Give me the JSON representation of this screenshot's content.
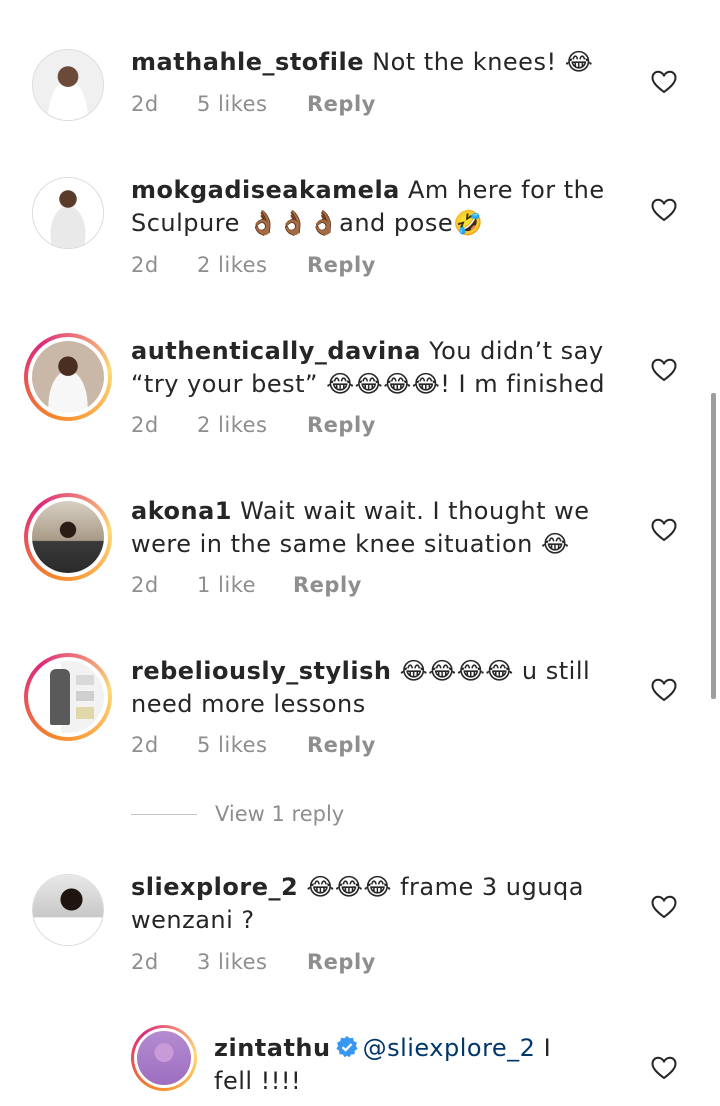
{
  "comments": [
    {
      "username": "mathahle_stofile",
      "text": "Not the knees! 😂",
      "time": "2d",
      "likes": "5 likes",
      "reply": "Reply"
    },
    {
      "username": "mokgadiseakamela",
      "text": "Am here for the Sculpure 👌🏾👌🏾👌🏾and pose🤣",
      "time": "2d",
      "likes": "2 likes",
      "reply": "Reply"
    },
    {
      "username": "authentically_davina",
      "text": "You didn’t say “try your best” 😂😂😂😂! I m finished",
      "time": "2d",
      "likes": "2 likes",
      "reply": "Reply"
    },
    {
      "username": "akona1",
      "text": "Wait wait wait. I thought we were in the same knee situation 😂",
      "time": "2d",
      "likes": "1 like",
      "reply": "Reply"
    },
    {
      "username": "rebeliously_stylish",
      "text": "😂😂😂😂 u still need more lessons",
      "time": "2d",
      "likes": "5 likes",
      "reply": "Reply"
    },
    {
      "username": "sliexplore_2",
      "text": "😂😂😂 frame 3 uguqa wenzani ?",
      "time": "2d",
      "likes": "3 likes",
      "reply": "Reply"
    }
  ],
  "view_replies": "View 1 reply",
  "reply_thread": {
    "username": "zintathu",
    "mention": "@sliexplore_2",
    "text": "I fell !!!!"
  },
  "colors": {
    "text": "#262626",
    "meta": "#8e8e8e",
    "mention": "#00376b",
    "verified": "#3897f0"
  },
  "icons": {
    "like": "heart-outline-icon",
    "verified": "verified-badge-icon"
  }
}
